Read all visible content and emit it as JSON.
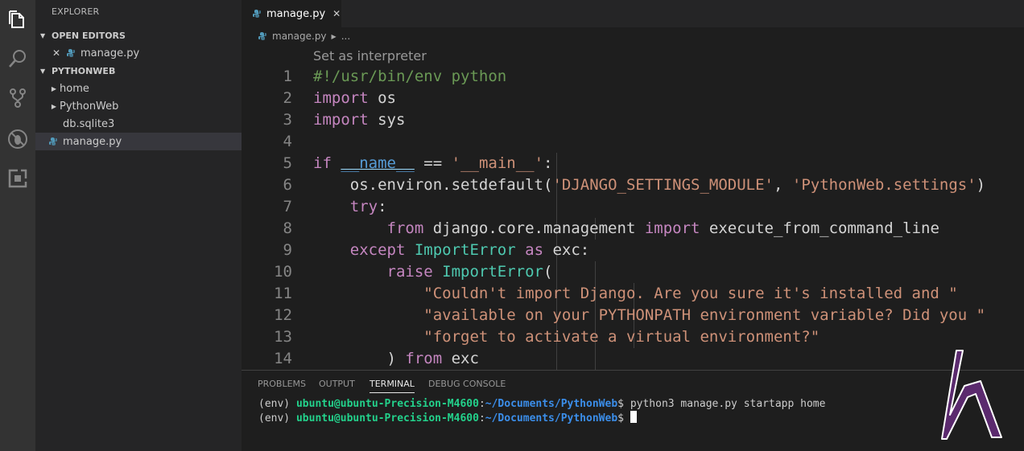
{
  "activity_bar": {
    "icons": [
      "explorer-icon",
      "search-icon",
      "source-control-icon",
      "debug-icon",
      "extensions-icon"
    ]
  },
  "sidebar": {
    "title": "EXPLORER",
    "open_editors": {
      "label": "OPEN EDITORS",
      "items": [
        {
          "label": "manage.py"
        }
      ]
    },
    "workspace": {
      "label": "PYTHONWEB",
      "items": [
        {
          "label": "home",
          "type": "folder"
        },
        {
          "label": "PythonWeb",
          "type": "folder"
        },
        {
          "label": "db.sqlite3",
          "type": "file"
        },
        {
          "label": "manage.py",
          "type": "python"
        }
      ]
    }
  },
  "editor": {
    "tab": {
      "label": "manage.py"
    },
    "breadcrumb": {
      "file": "manage.py",
      "more": "..."
    },
    "codelens": "Set as interpreter",
    "line_numbers": [
      "1",
      "2",
      "3",
      "4",
      "5",
      "6",
      "7",
      "8",
      "9",
      "10",
      "11",
      "12",
      "13",
      "14"
    ],
    "code": {
      "l1": "#!/usr/bin/env python",
      "l2_kw": "import",
      "l2_rest": " os",
      "l3_kw": "import",
      "l3_rest": " sys",
      "l5_if": "if",
      "l5_name": "__name__",
      "l5_eq": " == ",
      "l5_str": "'__main__'",
      "l5_colon": ":",
      "l6_a": "os.environ.setdefault(",
      "l6_s1": "'DJANGO_SETTINGS_MODULE'",
      "l6_b": ", ",
      "l6_s2": "'PythonWeb.settings'",
      "l6_c": ")",
      "l7_kw": "try",
      "l7_colon": ":",
      "l8_from": "from",
      "l8_mod": " django.core.management ",
      "l8_import": "import",
      "l8_rest": " execute_from_command_line",
      "l9_kw": "except",
      "l9_cls": "ImportError",
      "l9_as": "as",
      "l9_rest": " exc:",
      "l10_kw": "raise",
      "l10_cls": "ImportError",
      "l10_rest": "(",
      "l11": "\"Couldn't import Django. Are you sure it's installed and \"",
      "l12": "\"available on your PYTHONPATH environment variable? Did you \"",
      "l13": "\"forget to activate a virtual environment?\"",
      "l14_a": ") ",
      "l14_from": "from",
      "l14_rest": " exc"
    }
  },
  "panel": {
    "tabs": [
      "PROBLEMS",
      "OUTPUT",
      "TERMINAL",
      "DEBUG CONSOLE"
    ],
    "active_tab": "TERMINAL",
    "terminal": {
      "env": "(env) ",
      "user_host": "ubuntu@ubuntu-Precision-M4600",
      "colon": ":",
      "path": "~/Documents/PythonWeb",
      "prompt": "$ ",
      "command": "python3 manage.py startapp home"
    }
  },
  "colors": {
    "activity_bar": "#333333",
    "sidebar": "#252526",
    "editor_bg": "#1e1e1e",
    "keyword": "#c586c0",
    "builtin": "#569cd6",
    "string": "#ce9178",
    "comment": "#6a9955",
    "class": "#4ec9b0",
    "terminal_user": "#23d18b",
    "terminal_path": "#3b8eea",
    "logo": "#5b2a6e"
  }
}
